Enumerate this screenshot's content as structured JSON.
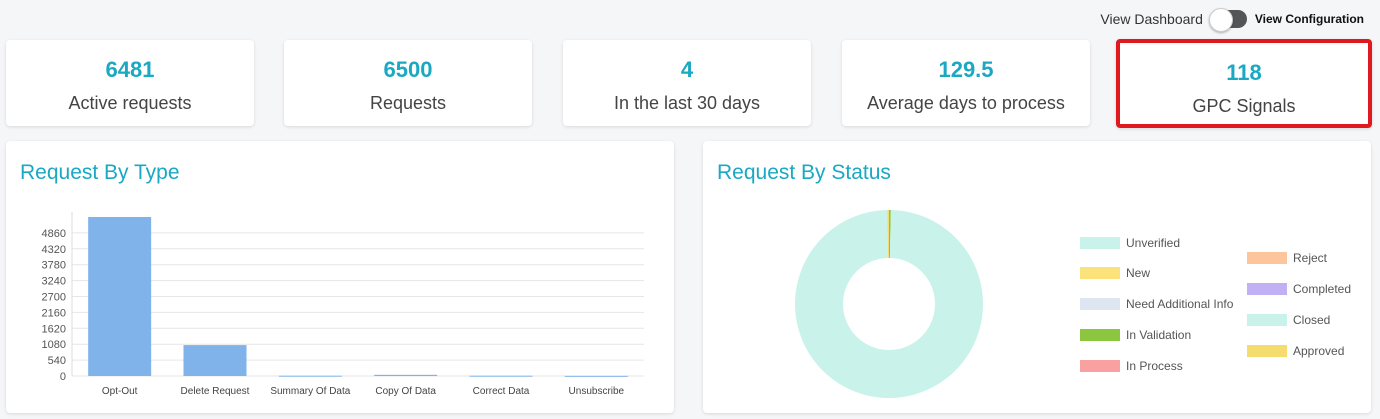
{
  "toolbar": {
    "view_dashboard": "View Dashboard",
    "view_configuration": "View Configuration"
  },
  "stats": [
    {
      "value": "6481",
      "label": "Active requests"
    },
    {
      "value": "6500",
      "label": "Requests"
    },
    {
      "value": "4",
      "label": "In the last 30 days"
    },
    {
      "value": "129.5",
      "label": "Average days to process"
    },
    {
      "value": "118",
      "label": "GPC Signals"
    }
  ],
  "panels": {
    "type_title": "Request By Type",
    "status_title": "Request By Status"
  },
  "colors": {
    "accent": "#1aa8c2",
    "highlight": "#e0191e",
    "bar": "#7fb3ea"
  },
  "chart_data": [
    {
      "type": "bar",
      "title": "Request By Type",
      "categories": [
        "Opt-Out",
        "Delete Request",
        "Summary Of Data",
        "Copy Of Data",
        "Correct Data",
        "Unsubscribe"
      ],
      "values": [
        5400,
        1050,
        10,
        40,
        10,
        5
      ],
      "yticks": [
        0,
        540,
        1080,
        1620,
        2160,
        2700,
        3240,
        3780,
        4320,
        4860
      ],
      "ylim": [
        0,
        5400
      ],
      "grid": true
    },
    {
      "type": "pie",
      "title": "Request By Status",
      "legend": [
        {
          "label": "Unverified",
          "color": "#c8f2ea",
          "value": 0
        },
        {
          "label": "New",
          "color": "#fbe27a",
          "value": 0
        },
        {
          "label": "Need Additional Info",
          "color": "#dde6f0",
          "value": 0
        },
        {
          "label": "In Validation",
          "color": "#8cc63e",
          "value": 20
        },
        {
          "label": "In Process",
          "color": "#f9a0a0",
          "value": 0
        },
        {
          "label": "Reject",
          "color": "#fdc59c",
          "value": 0
        },
        {
          "label": "Completed",
          "color": "#c2b0f5",
          "value": 0
        },
        {
          "label": "Closed",
          "color": "#c8f2ea",
          "value": 6460
        },
        {
          "label": "Approved",
          "color": "#f4dd6e",
          "value": 20
        }
      ]
    }
  ]
}
